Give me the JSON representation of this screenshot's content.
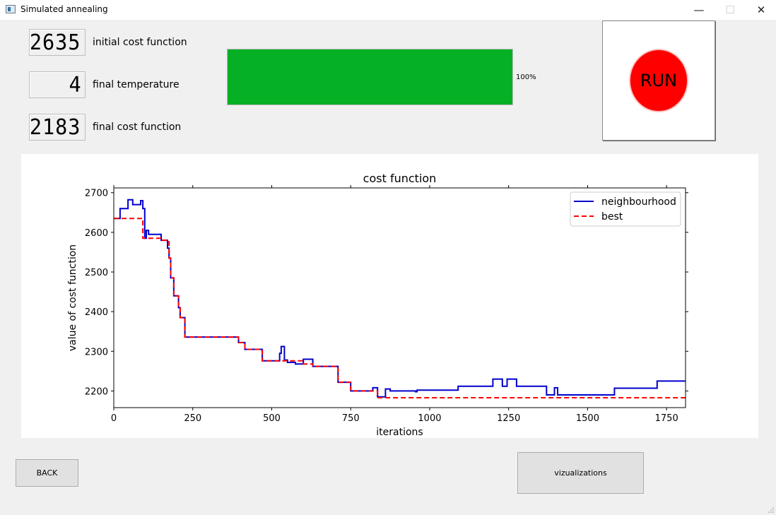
{
  "window": {
    "title": "Simulated annealing",
    "minimize_symbol": "—",
    "maximize_symbol": "☐",
    "close_symbol": "✕"
  },
  "metrics": {
    "initial_cost": {
      "value": "2635",
      "label": "initial cost function"
    },
    "final_temperature": {
      "value": "4",
      "label": "final temperature"
    },
    "final_cost": {
      "value": "2183",
      "label": "final cost function"
    }
  },
  "progress": {
    "value": 1.0,
    "text": "100%",
    "color": "#06b025"
  },
  "run_button": {
    "label": "RUN",
    "color": "#ff0000"
  },
  "buttons": {
    "back": "BACK",
    "visualizations": "vizualizations"
  },
  "chart_data": {
    "type": "line",
    "title": "cost function",
    "xlabel": "iterations",
    "ylabel": "value of cost function",
    "xlim": [
      0,
      1810
    ],
    "ylim": [
      2158,
      2712
    ],
    "xticks": [
      0,
      250,
      500,
      750,
      1000,
      1250,
      1500,
      1750
    ],
    "yticks": [
      2200,
      2300,
      2400,
      2500,
      2600,
      2700
    ],
    "legend_position": "top-right",
    "series": [
      {
        "name": "neighbourhood",
        "color": "#0000cc",
        "style": "solid",
        "x": [
          0,
          20,
          20,
          45,
          45,
          60,
          60,
          85,
          85,
          92,
          92,
          98,
          98,
          103,
          103,
          110,
          110,
          150,
          150,
          170,
          170,
          175,
          175,
          180,
          180,
          190,
          190,
          205,
          205,
          210,
          210,
          225,
          225,
          250,
          250,
          395,
          395,
          415,
          415,
          470,
          470,
          525,
          525,
          530,
          530,
          540,
          540,
          550,
          550,
          575,
          575,
          600,
          600,
          630,
          630,
          680,
          680,
          710,
          710,
          750,
          750,
          820,
          820,
          835,
          835,
          860,
          860,
          875,
          875,
          955,
          955,
          960,
          960,
          1090,
          1090,
          1200,
          1200,
          1230,
          1230,
          1245,
          1245,
          1275,
          1275,
          1370,
          1370,
          1395,
          1395,
          1405,
          1405,
          1585,
          1585,
          1720,
          1720,
          1810
        ],
        "y": [
          2635,
          2635,
          2660,
          2660,
          2682,
          2682,
          2670,
          2670,
          2680,
          2680,
          2660,
          2660,
          2585,
          2585,
          2605,
          2605,
          2595,
          2595,
          2580,
          2580,
          2560,
          2560,
          2535,
          2535,
          2485,
          2485,
          2440,
          2440,
          2410,
          2410,
          2385,
          2385,
          2336,
          2336,
          2336,
          2336,
          2322,
          2322,
          2305,
          2305,
          2276,
          2276,
          2295,
          2295,
          2312,
          2312,
          2278,
          2278,
          2272,
          2272,
          2268,
          2268,
          2280,
          2280,
          2262,
          2262,
          2262,
          2262,
          2222,
          2222,
          2200,
          2200,
          2208,
          2208,
          2185,
          2185,
          2205,
          2205,
          2200,
          2200,
          2198,
          2198,
          2202,
          2202,
          2212,
          2212,
          2230,
          2230,
          2212,
          2212,
          2230,
          2230,
          2212,
          2212,
          2190,
          2190,
          2208,
          2208,
          2190,
          2190,
          2207,
          2207,
          2225,
          2225
        ]
      },
      {
        "name": "best",
        "color": "#ff0000",
        "style": "dashed",
        "x": [
          0,
          92,
          92,
          150,
          150,
          175,
          175,
          180,
          180,
          190,
          190,
          205,
          205,
          210,
          210,
          225,
          225,
          250,
          250,
          395,
          395,
          415,
          415,
          470,
          470,
          600,
          600,
          630,
          630,
          710,
          710,
          750,
          750,
          835,
          835,
          1810
        ],
        "y": [
          2635,
          2635,
          2585,
          2585,
          2580,
          2580,
          2535,
          2535,
          2485,
          2485,
          2440,
          2440,
          2410,
          2410,
          2385,
          2385,
          2336,
          2336,
          2336,
          2336,
          2322,
          2322,
          2305,
          2305,
          2276,
          2276,
          2268,
          2268,
          2262,
          2262,
          2222,
          2222,
          2200,
          2200,
          2183,
          2183
        ]
      }
    ]
  }
}
